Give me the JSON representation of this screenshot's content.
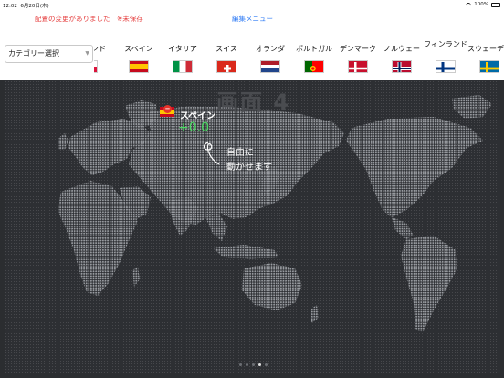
{
  "status_bar": {
    "time": "12:02",
    "date": "6月20日(木)",
    "battery": "100%"
  },
  "nav": {
    "unsaved_message": "配置の変更がありました　※未保存",
    "edit_menu": "編集メニュー"
  },
  "toolbar": {
    "category_select": "カテゴリー選択"
  },
  "flags": [
    {
      "label": "ポーランド",
      "icon": "flag-partial"
    },
    {
      "label": "スペイン",
      "icon": "flag-spain"
    },
    {
      "label": "イタリア",
      "icon": "flag-italy"
    },
    {
      "label": "スイス",
      "icon": "flag-switzerland"
    },
    {
      "label": "オランダ",
      "icon": "flag-netherlands"
    },
    {
      "label": "ポルトガル",
      "icon": "flag-portugal"
    },
    {
      "label": "デンマーク",
      "icon": "flag-denmark"
    },
    {
      "label": "ノルウェー",
      "icon": "flag-norway"
    },
    {
      "label": "フィンランド",
      "icon": "flag-finland"
    },
    {
      "label": "スウェーデン",
      "icon": "flag-sweden"
    }
  ],
  "map": {
    "screen_label": "画面 4"
  },
  "widget": {
    "name": "スペイン",
    "value": "+0.0",
    "badge": "−"
  },
  "hint": {
    "line1": "自由に",
    "line2": "動かせます"
  },
  "pagination": {
    "total": 5,
    "current": 4
  },
  "colors": {
    "unsaved": "#e64040",
    "link": "#2f7bf5",
    "value_positive": "#4cd964",
    "map_bg": "#2d2f33"
  }
}
